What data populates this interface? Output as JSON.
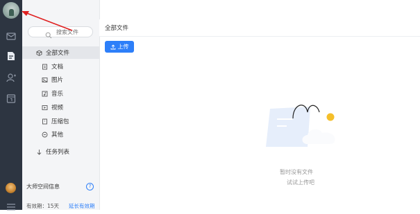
{
  "rail": {
    "icons": [
      "mail-icon",
      "files-icon",
      "contacts-icon",
      "calendar-icon"
    ]
  },
  "sidebar": {
    "search_placeholder": "搜索文件",
    "items": [
      {
        "label": "全部文件",
        "icon": "cube-icon",
        "active": true
      },
      {
        "label": "文档",
        "icon": "doc-icon",
        "active": false
      },
      {
        "label": "图片",
        "icon": "image-icon",
        "active": false
      },
      {
        "label": "音乐",
        "icon": "music-icon",
        "active": false
      },
      {
        "label": "视频",
        "icon": "video-icon",
        "active": false
      },
      {
        "label": "压缩包",
        "icon": "zip-icon",
        "active": false
      },
      {
        "label": "其他",
        "icon": "other-icon",
        "active": false
      },
      {
        "label": "任务列表",
        "icon": "task-icon",
        "active": false
      }
    ],
    "space_title": "大师空间信息",
    "help": "?",
    "validity": "有效期：15天",
    "extend_link": "延长有效期"
  },
  "main": {
    "title": "全部文件",
    "upload_label": "上传",
    "empty_title": "暂时没有文件",
    "empty_sub": "试试上传吧"
  },
  "colors": {
    "accent": "#2d7ff9",
    "rail_bg": "#2d3541",
    "annotation": "#e02020"
  }
}
